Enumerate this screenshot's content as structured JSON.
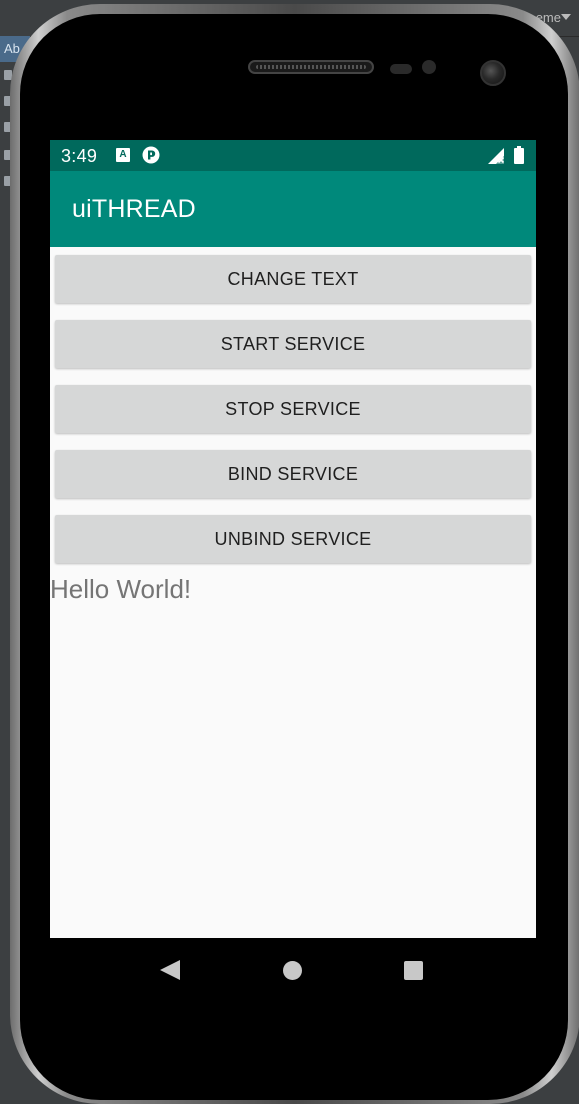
{
  "ide": {
    "tab_label": "Ab",
    "theme_label": "eme"
  },
  "status_bar": {
    "time": "3:49",
    "notification_icon_letter": "A",
    "color": "#00695c"
  },
  "app_bar": {
    "title": "uiTHREAD",
    "color": "#00897b"
  },
  "buttons": [
    {
      "label": "CHANGE TEXT"
    },
    {
      "label": "START SERVICE"
    },
    {
      "label": "STOP SERVICE"
    },
    {
      "label": "BIND SERVICE"
    },
    {
      "label": "UNBIND SERVICE"
    }
  ],
  "main": {
    "hello_text": "Hello World!"
  },
  "icons": {
    "status": [
      "text-notification-icon",
      "pocket-casts-icon",
      "signal-no-data-icon",
      "battery-icon"
    ],
    "nav": [
      "back-icon",
      "home-icon",
      "recents-icon"
    ]
  }
}
